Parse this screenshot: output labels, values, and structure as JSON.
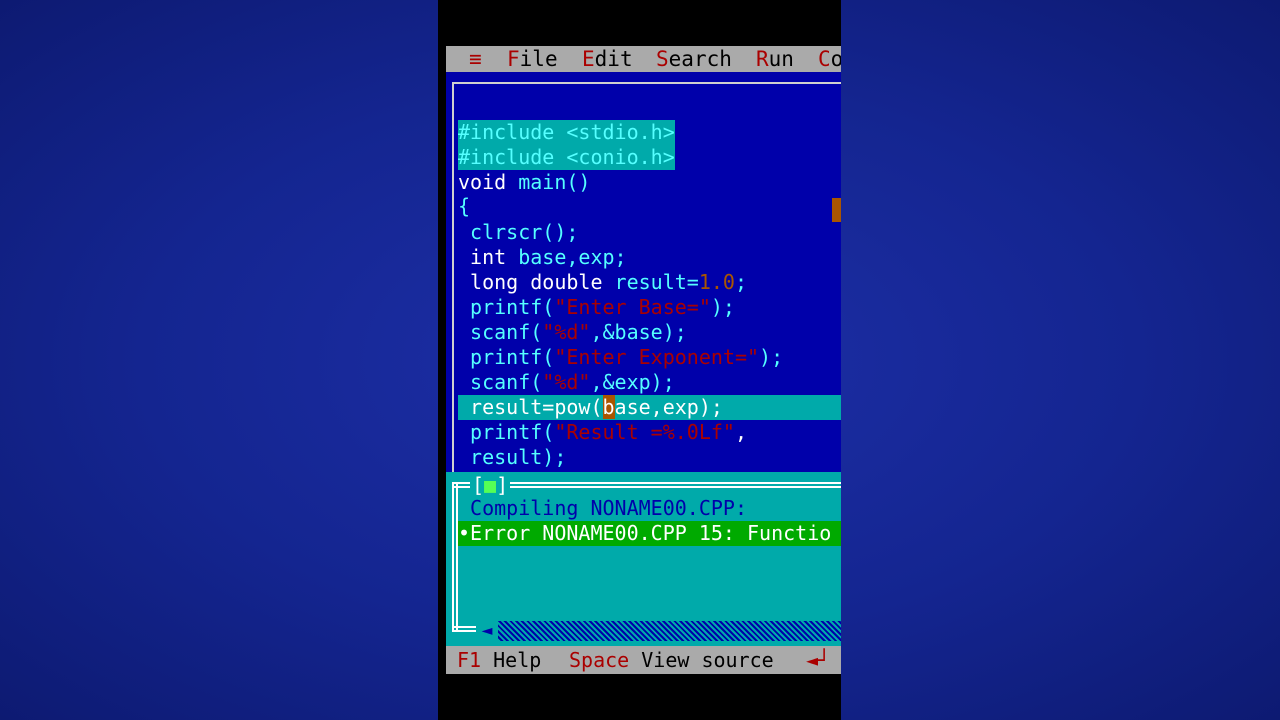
{
  "menu": {
    "system_glyph": "≡",
    "items": [
      {
        "hotkey": "F",
        "rest": "ile"
      },
      {
        "hotkey": "E",
        "rest": "dit"
      },
      {
        "hotkey": "S",
        "rest": "earch"
      },
      {
        "hotkey": "R",
        "rest": "un"
      },
      {
        "hotkey": "C",
        "rest": "o"
      }
    ]
  },
  "editor": {
    "lines": {
      "l1": "#include <stdio.h>",
      "l2": "#include <conio.h>",
      "l3_kw": "void",
      "l3_rest": "main()",
      "l4": "{",
      "l5": "clrscr();",
      "l6_kw": "int",
      "l6_rest": "base,exp;",
      "l7_kw": "long double",
      "l7_rest": "result=",
      "l7_num": "1.0",
      "l7_end": ";",
      "l8_fn": "printf(",
      "l8_str": "\"Enter Base=\"",
      "l8_end": ");",
      "l9_fn": "scanf(",
      "l9_str": "\"%d\"",
      "l9_end": ",&base);",
      "l10_fn": "printf(",
      "l10_str": "\"Enter Exponent=\"",
      "l10_end": ");",
      "l11_fn": "scanf(",
      "l11_str": "\"%d\"",
      "l11_end": ",&exp);",
      "l12_pre": "result=pow(",
      "l12_cursor": "b",
      "l12_post": "ase,exp);",
      "l13_fn": "printf(",
      "l13_str": "\"Result =%.0Lf\"",
      "l13_end": ",",
      "l14": "result);"
    }
  },
  "messages": {
    "close_left": "[",
    "close_mark": "■",
    "close_right": "]",
    "compile": "Compiling NONAME00.CPP:",
    "error": "•Error NONAME00.CPP 15: Functio",
    "scroll_arrow": "◄"
  },
  "status": {
    "f1_key": "F1",
    "f1_label": "Help",
    "space_key": "Space",
    "space_label": "View source",
    "enter_key": "◄┘"
  },
  "colors": {
    "page_background": "#142590",
    "editor_background": "#0000aa",
    "message_background": "#00aaaa",
    "error_highlight": "#00aa00",
    "menu_background": "#aaaaaa"
  }
}
